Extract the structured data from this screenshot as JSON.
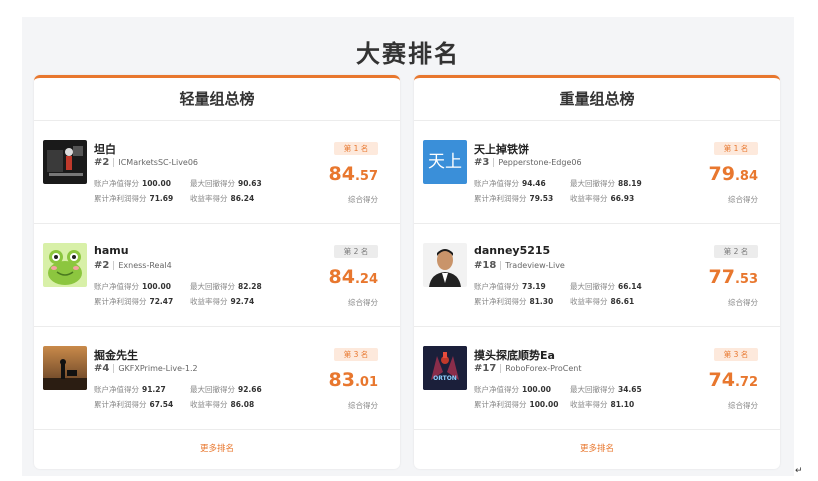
{
  "page_title": "大赛排名",
  "colors": {
    "accent": "#e8772e"
  },
  "boards": [
    {
      "title": "轻量组总榜",
      "more_label": "更多排名",
      "entries": [
        {
          "name": "坦白",
          "rank_no": "#2",
          "account": "ICMarketsSC-Live06",
          "place": "第 1 名",
          "m1_label": "账户净值得分",
          "m1": "100.00",
          "m2_label": "最大回撤得分",
          "m2": "90.63",
          "m3_label": "累计净利润得分",
          "m3": "71.69",
          "m4_label": "收益率得分",
          "m4": "86.24",
          "score_int": "84",
          "score_dec": ".57",
          "score_label": "综合得分"
        },
        {
          "name": "hamu",
          "rank_no": "#2",
          "account": "Exness-Real4",
          "place": "第 2 名",
          "m1_label": "账户净值得分",
          "m1": "100.00",
          "m2_label": "最大回撤得分",
          "m2": "82.28",
          "m3_label": "累计净利润得分",
          "m3": "72.47",
          "m4_label": "收益率得分",
          "m4": "92.74",
          "score_int": "84",
          "score_dec": ".24",
          "score_label": "综合得分"
        },
        {
          "name": "掘金先生",
          "rank_no": "#4",
          "account": "GKFXPrime-Live-1.2",
          "place": "第 3 名",
          "m1_label": "账户净值得分",
          "m1": "91.27",
          "m2_label": "最大回撤得分",
          "m2": "92.66",
          "m3_label": "累计净利润得分",
          "m3": "67.54",
          "m4_label": "收益率得分",
          "m4": "86.08",
          "score_int": "83",
          "score_dec": ".01",
          "score_label": "综合得分"
        }
      ]
    },
    {
      "title": "重量组总榜",
      "more_label": "更多排名",
      "entries": [
        {
          "name": "天上掉铁饼",
          "rank_no": "#3",
          "account": "Pepperstone-Edge06",
          "place": "第 1 名",
          "avatar_text": "天上",
          "m1_label": "账户净值得分",
          "m1": "94.46",
          "m2_label": "最大回撤得分",
          "m2": "88.19",
          "m3_label": "累计净利润得分",
          "m3": "79.53",
          "m4_label": "收益率得分",
          "m4": "66.93",
          "score_int": "79",
          "score_dec": ".84",
          "score_label": "综合得分"
        },
        {
          "name": "danney5215",
          "rank_no": "#18",
          "account": "Tradeview-Live",
          "place": "第 2 名",
          "m1_label": "账户净值得分",
          "m1": "73.19",
          "m2_label": "最大回撤得分",
          "m2": "66.14",
          "m3_label": "累计净利润得分",
          "m3": "81.30",
          "m4_label": "收益率得分",
          "m4": "86.61",
          "score_int": "77",
          "score_dec": ".53",
          "score_label": "综合得分"
        },
        {
          "name": "摸头探底顺势Ea",
          "rank_no": "#17",
          "account": "RoboForex-ProCent",
          "place": "第 3 名",
          "avatar_text": "ORTON",
          "m1_label": "账户净值得分",
          "m1": "100.00",
          "m2_label": "最大回撤得分",
          "m2": "34.65",
          "m3_label": "累计净利润得分",
          "m3": "100.00",
          "m4_label": "收益率得分",
          "m4": "81.10",
          "score_int": "74",
          "score_dec": ".72",
          "score_label": "综合得分"
        }
      ]
    }
  ]
}
